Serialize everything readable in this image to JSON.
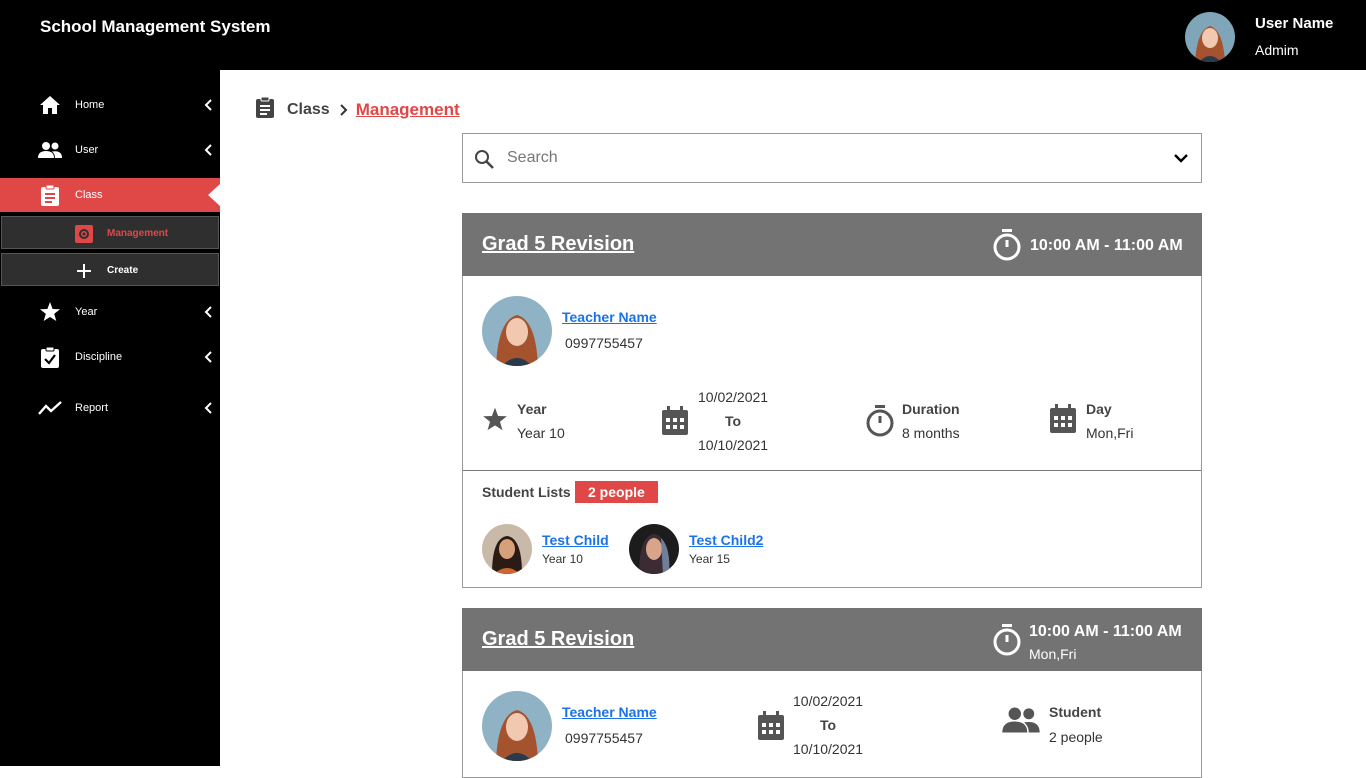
{
  "app": {
    "title": "School Management System"
  },
  "user": {
    "name": "User Name",
    "role": "Admim"
  },
  "sidebar": {
    "items": [
      {
        "label": "Home",
        "icon": "home-icon"
      },
      {
        "label": "User",
        "icon": "users-icon"
      },
      {
        "label": "Class",
        "icon": "clipboard-icon",
        "active": true
      },
      {
        "label": "Year",
        "icon": "star-icon"
      },
      {
        "label": "Discipline",
        "icon": "checklist-icon"
      },
      {
        "label": "Report",
        "icon": "trend-icon"
      }
    ],
    "sub_items": [
      {
        "label": "Management",
        "icon": "gear-icon",
        "active": true
      },
      {
        "label": "Create",
        "icon": "plus-icon"
      }
    ]
  },
  "breadcrumb": {
    "parent": "Class",
    "current": "Management"
  },
  "search": {
    "placeholder": "Search"
  },
  "cards": [
    {
      "title": "Grad 5 Revision",
      "time": "10:00 AM - 11:00 AM",
      "teacher": {
        "name": "Teacher Name",
        "phone": "0997755457"
      },
      "year": {
        "label": "Year",
        "value": "Year 10"
      },
      "dates": {
        "start": "10/02/2021",
        "to": "To",
        "end": "10/10/2021"
      },
      "duration": {
        "label": "Duration",
        "value": "8 months"
      },
      "day": {
        "label": "Day",
        "value": "Mon,Fri"
      },
      "students": {
        "label": "Student Lists",
        "count": "2 people",
        "list": [
          {
            "name": "Test Child",
            "year": "Year 10"
          },
          {
            "name": "Test Child2",
            "year": "Year 15"
          }
        ]
      }
    },
    {
      "title": "Grad 5 Revision",
      "time": "10:00 AM - 11:00 AM",
      "days": "Mon,Fri",
      "teacher": {
        "name": "Teacher Name",
        "phone": "0997755457"
      },
      "dates": {
        "start": "10/02/2021",
        "to": "To",
        "end": "10/10/2021"
      },
      "students": {
        "label": "Student",
        "value": "2 people"
      }
    }
  ],
  "colors": {
    "accent": "#e04848",
    "card_header": "#737373",
    "link": "#1a73e8",
    "sidebar": "#000000"
  }
}
